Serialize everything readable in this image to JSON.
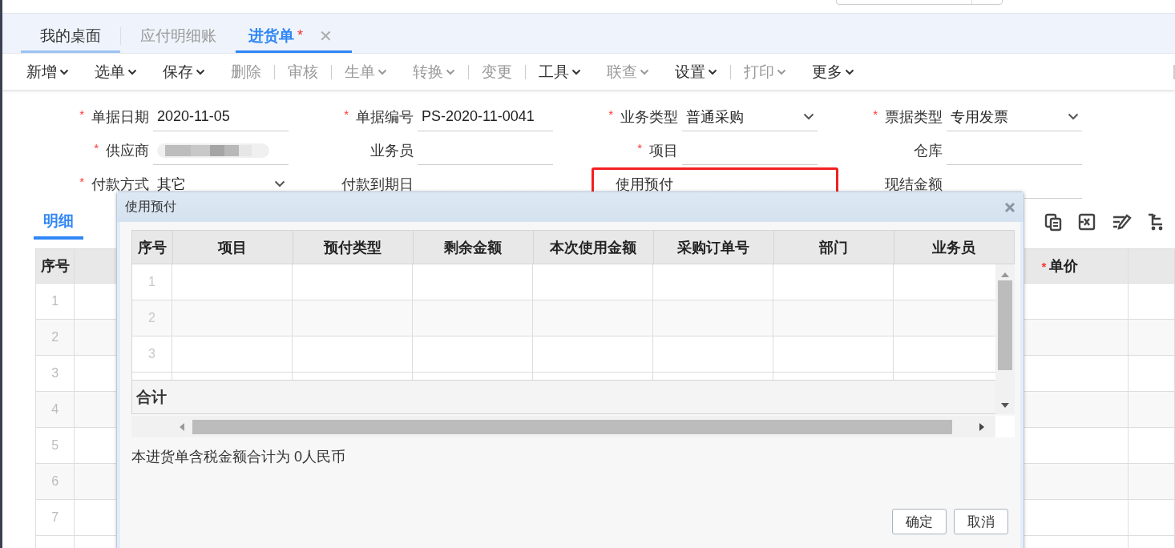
{
  "tabs": [
    {
      "label": "我的桌面",
      "selected": false,
      "underlined": true,
      "dimmed": false,
      "modified": false,
      "closable": false
    },
    {
      "label": "应付明细账",
      "selected": false,
      "underlined": false,
      "dimmed": true,
      "modified": false,
      "closable": false
    },
    {
      "label": "进货单",
      "selected": true,
      "underlined": false,
      "dimmed": false,
      "modified": true,
      "closable": true,
      "modified_mark": "*",
      "close_glyph": "✕"
    }
  ],
  "toolbar": [
    {
      "label": "新增",
      "dropdown": true,
      "disabled": false,
      "divider_after": false
    },
    {
      "label": "选单",
      "dropdown": true,
      "disabled": false,
      "divider_after": false
    },
    {
      "label": "保存",
      "dropdown": true,
      "disabled": false,
      "divider_after": false
    },
    {
      "label": "删除",
      "dropdown": false,
      "disabled": true,
      "divider_after": true
    },
    {
      "label": "审核",
      "dropdown": false,
      "disabled": true,
      "divider_after": true
    },
    {
      "label": "生单",
      "dropdown": true,
      "disabled": true,
      "divider_after": false
    },
    {
      "label": "转换",
      "dropdown": true,
      "disabled": true,
      "divider_after": true
    },
    {
      "label": "变更",
      "dropdown": false,
      "disabled": true,
      "divider_after": true
    },
    {
      "label": "工具",
      "dropdown": true,
      "disabled": false,
      "divider_after": false
    },
    {
      "label": "联查",
      "dropdown": true,
      "disabled": true,
      "divider_after": false
    },
    {
      "label": "设置",
      "dropdown": true,
      "disabled": false,
      "divider_after": true
    },
    {
      "label": "打印",
      "dropdown": true,
      "disabled": true,
      "divider_after": false
    },
    {
      "label": "更多",
      "dropdown": true,
      "disabled": false,
      "divider_after": false
    }
  ],
  "form": [
    {
      "label": "单据日期",
      "required": true,
      "kind": "text",
      "value": "2020-11-05",
      "highlighted": false
    },
    {
      "label": "单据编号",
      "required": true,
      "kind": "text",
      "value": "PS-2020-11-0041",
      "highlighted": false
    },
    {
      "label": "业务类型",
      "required": true,
      "kind": "select",
      "value": "普通采购",
      "highlighted": false
    },
    {
      "label": "票据类型",
      "required": true,
      "kind": "select",
      "value": "专用发票",
      "highlighted": false
    },
    {
      "label": "供应商",
      "required": true,
      "kind": "redacted",
      "highlighted": false
    },
    {
      "label": "业务员",
      "required": false,
      "kind": "text",
      "highlighted": false
    },
    {
      "label": "项目",
      "required": true,
      "kind": "text",
      "highlighted": false
    },
    {
      "label": "仓库",
      "required": false,
      "kind": "text",
      "highlighted": false
    },
    {
      "label": "付款方式",
      "required": true,
      "kind": "select",
      "value": "其它",
      "highlighted": false
    },
    {
      "label": "付款到期日",
      "required": false,
      "highlighted": false
    },
    {
      "label": "使用预付",
      "required": false,
      "kind": "text",
      "highlighted": true
    },
    {
      "label": "现结金额",
      "required": false,
      "kind": "text",
      "highlighted": false
    }
  ],
  "required_mark": "*",
  "detail": {
    "tab": {
      "label": "明细",
      "selected": true
    },
    "columns": [
      {
        "label": "序号",
        "required": false
      },
      {
        "label": "单价",
        "required": true
      }
    ],
    "rows": [
      {
        "index": "1"
      },
      {
        "index": "2"
      },
      {
        "index": "3"
      },
      {
        "index": "4"
      },
      {
        "index": "5"
      },
      {
        "index": "6"
      },
      {
        "index": "7"
      }
    ]
  },
  "dialog": {
    "title": "使用预付",
    "columns": [
      "序号",
      "项目",
      "预付类型",
      "剩余金额",
      "本次使用金额",
      "采购订单号",
      "部门",
      "业务员"
    ],
    "rows": [
      {
        "index": "1"
      },
      {
        "index": "2"
      },
      {
        "index": "3"
      }
    ],
    "summary_label": "合计",
    "note": "本进货单含税金额合计为 0人民币",
    "buttons": [
      "确定",
      "取消"
    ]
  }
}
